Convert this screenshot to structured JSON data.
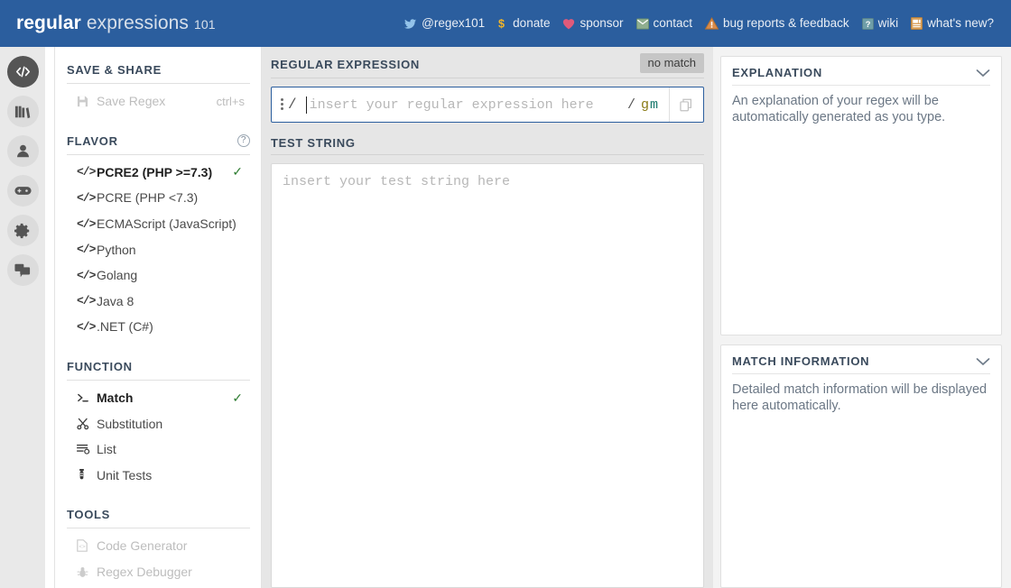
{
  "header": {
    "brand": {
      "bold": "regular",
      "normal": "expressions",
      "suffix": "101"
    },
    "nav": [
      {
        "icon": "twitter-icon",
        "label": "@regex101"
      },
      {
        "icon": "dollar-icon",
        "label": "donate"
      },
      {
        "icon": "heart-icon",
        "label": "sponsor"
      },
      {
        "icon": "envelope-icon",
        "label": "contact"
      },
      {
        "icon": "warning-icon",
        "label": "bug reports & feedback"
      },
      {
        "icon": "wiki-icon",
        "label": "wiki"
      },
      {
        "icon": "news-icon",
        "label": "what's new?"
      }
    ]
  },
  "rail": [
    {
      "icon": "code-icon",
      "name": "regex-editor",
      "active": true
    },
    {
      "icon": "library-icon",
      "name": "library",
      "active": false
    },
    {
      "icon": "account-icon",
      "name": "account",
      "active": false
    },
    {
      "icon": "gamepad-icon",
      "name": "quiz",
      "active": false
    },
    {
      "icon": "gear-icon",
      "name": "settings",
      "active": false
    },
    {
      "icon": "chat-icon",
      "name": "community",
      "active": false
    }
  ],
  "sidebar": {
    "save_share": {
      "title": "SAVE & SHARE",
      "items": [
        {
          "icon": "floppy-icon",
          "label": "Save Regex",
          "shortcut": "ctrl+s",
          "disabled": true
        }
      ]
    },
    "flavor": {
      "title": "FLAVOR",
      "help": "?",
      "items": [
        {
          "icon": "code-tag-icon",
          "label": "PCRE2 (PHP >=7.3)",
          "selected": true
        },
        {
          "icon": "code-tag-icon",
          "label": "PCRE (PHP <7.3)",
          "selected": false
        },
        {
          "icon": "code-tag-icon",
          "label": "ECMAScript (JavaScript)",
          "selected": false
        },
        {
          "icon": "code-tag-icon",
          "label": "Python",
          "selected": false
        },
        {
          "icon": "code-tag-icon",
          "label": "Golang",
          "selected": false
        },
        {
          "icon": "code-tag-icon",
          "label": "Java 8",
          "selected": false
        },
        {
          "icon": "code-tag-icon",
          "label": ".NET (C#)",
          "selected": false
        }
      ]
    },
    "function": {
      "title": "FUNCTION",
      "items": [
        {
          "icon": "terminal-icon",
          "label": "Match",
          "selected": true
        },
        {
          "icon": "scissors-icon",
          "label": "Substitution",
          "selected": false
        },
        {
          "icon": "list-icon",
          "label": "List",
          "selected": false
        },
        {
          "icon": "testtube-icon",
          "label": "Unit Tests",
          "selected": false
        }
      ]
    },
    "tools": {
      "title": "TOOLS",
      "items": [
        {
          "icon": "file-code-icon",
          "label": "Code Generator",
          "disabled": true
        },
        {
          "icon": "bug-icon",
          "label": "Regex Debugger",
          "disabled": true
        }
      ]
    }
  },
  "main": {
    "regex_label": "REGULAR EXPRESSION",
    "match_badge": "no match",
    "regex_delimiter": "/",
    "regex_value": "",
    "regex_placeholder": "insert your regular expression here",
    "flags_slash": "/",
    "flag_g": "g",
    "flag_m": "m",
    "test_label": "TEST STRING",
    "test_value": "",
    "test_placeholder": "insert your test string here"
  },
  "right": {
    "explanation": {
      "title": "EXPLANATION",
      "text": "An explanation of your regex will be automatically generated as you type."
    },
    "match_information": {
      "title": "MATCH INFORMATION",
      "text": "Detailed match information will be displayed here automatically."
    }
  },
  "colors": {
    "header_blue": "#2b5e9e",
    "accent_check": "#2e7d32",
    "flag_g": "#8a7b17",
    "flag_m": "#1b7a6e",
    "badge_bg": "#c6c6c6"
  }
}
